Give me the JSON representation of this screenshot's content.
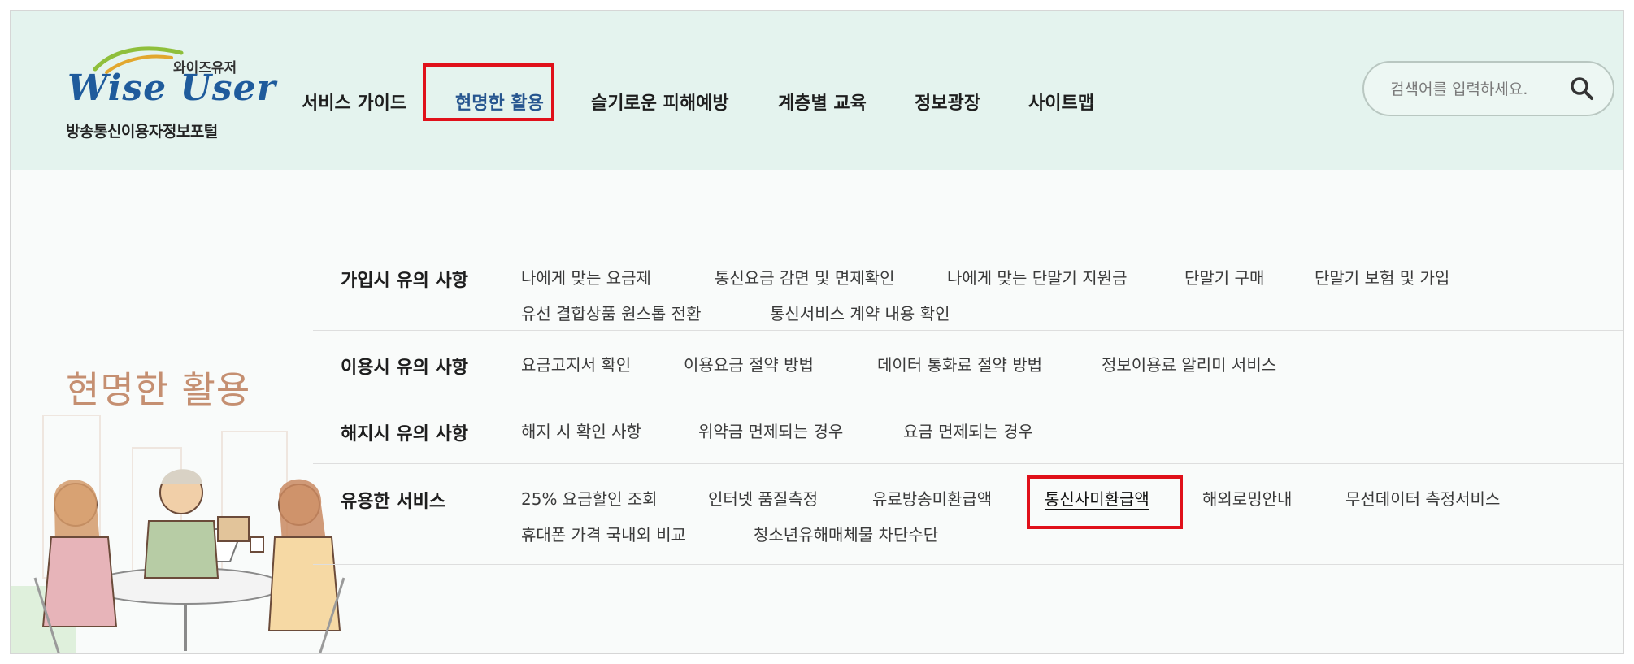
{
  "logo": {
    "sub": "와이즈유저",
    "main": "Wise User",
    "tagline": "방송통신이용자정보포털"
  },
  "gnb": {
    "items": [
      {
        "label": "서비스 가이드"
      },
      {
        "label": "현명한 활용"
      },
      {
        "label": "슬기로운 피해예방"
      },
      {
        "label": "계층별 교육"
      },
      {
        "label": "정보광장"
      },
      {
        "label": "사이트맵"
      }
    ],
    "active_index": 1
  },
  "search": {
    "placeholder": "검색어를 입력하세요.",
    "icon": "search-icon"
  },
  "section": {
    "title": "현명한 활용"
  },
  "submenu": {
    "rows": [
      {
        "title": "가입시 유의 사항",
        "links": [
          "나에게 맞는 요금제",
          "통신요금 감면 및 면제확인",
          "나에게 맞는 단말기 지원금",
          "단말기 구매",
          "단말기 보험 및 가입",
          "유선 결합상품 원스톱 전환",
          "통신서비스 계약 내용 확인"
        ]
      },
      {
        "title": "이용시 유의 사항",
        "links": [
          "요금고지서 확인",
          "이용요금 절약 방법",
          "데이터 통화료 절약 방법",
          "정보이용료 알리미 서비스"
        ]
      },
      {
        "title": "해지시 유의 사항",
        "links": [
          "해지 시 확인 사항",
          "위약금 면제되는 경우",
          "요금 면제되는 경우"
        ]
      },
      {
        "title": "유용한 서비스",
        "links": [
          "25% 요금할인 조회",
          "인터넷 품질측정",
          "유료방송미환급액",
          "통신사미환급액",
          "해외로밍안내",
          "무선데이터 측정서비스",
          "휴대폰 가격 국내외 비교",
          "청소년유해매체물 차단수단"
        ]
      }
    ]
  },
  "colors": {
    "header_bg": "#e4f3ee",
    "highlight_box": "#e0101a",
    "active_menu": "#26558f",
    "section_title": "#c58f71"
  }
}
